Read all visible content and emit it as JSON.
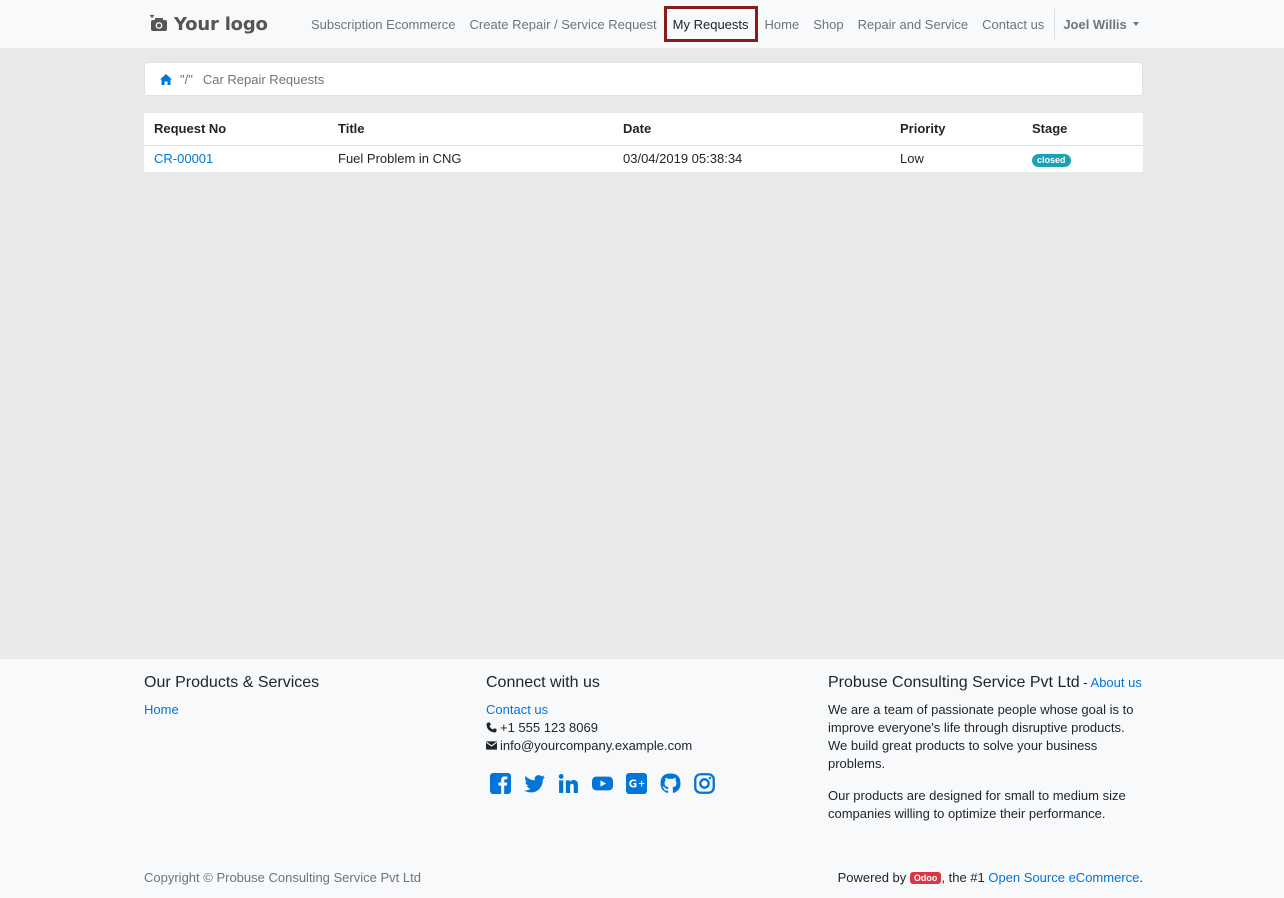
{
  "brand": {
    "logo_text": "Your logo",
    "logo_icon": "camera-icon"
  },
  "nav": {
    "items": [
      {
        "label": "Subscription Ecommerce"
      },
      {
        "label": "Create Repair / Service Request"
      },
      {
        "label": "My Requests",
        "active": true
      },
      {
        "label": "Home"
      },
      {
        "label": "Shop"
      },
      {
        "label": "Repair and Service"
      },
      {
        "label": "Contact us"
      }
    ],
    "user": "Joel Willis"
  },
  "breadcrumb": {
    "separator": "\"/\"",
    "current": "Car Repair Requests",
    "home_icon": "home-icon"
  },
  "table": {
    "headers": [
      "Request No",
      "Title",
      "Date",
      "Priority",
      "Stage"
    ],
    "rows": [
      {
        "request_no": "CR-00001",
        "title": "Fuel Problem in CNG",
        "date": "03/04/2019 05:38:34",
        "priority": "Low",
        "stage": "closed"
      }
    ]
  },
  "footer": {
    "products": {
      "heading": "Our Products & Services",
      "link": "Home"
    },
    "connect": {
      "heading": "Connect with us",
      "contact_link": "Contact us",
      "phone": "+1 555 123 8069",
      "email": "info@yourcompany.example.com",
      "socials": [
        "facebook-icon",
        "twitter-icon",
        "linkedin-icon",
        "youtube-icon",
        "google-plus-icon",
        "github-icon",
        "instagram-icon"
      ]
    },
    "company": {
      "heading": "Probuse Consulting Service Pvt Ltd",
      "heading_sep": " - ",
      "about_link": "About us",
      "para1": "We are a team of passionate people whose goal is to improve everyone's life through disruptive products. We build great products to solve your business problems.",
      "para2": "Our products are designed for small to medium size companies willing to optimize their performance."
    },
    "copyright": "Copyright © Probuse Consulting Service Pvt Ltd",
    "powered_prefix": "Powered by ",
    "powered_badge": "Odoo",
    "powered_middle": ", the #1 ",
    "powered_link": "Open Source eCommerce",
    "powered_suffix": "."
  },
  "colors": {
    "accent_link": "#0275d8",
    "active_outline": "#8b1a1a",
    "badge_stage": "#17a2b8",
    "odoo_badge": "#dc3545"
  }
}
